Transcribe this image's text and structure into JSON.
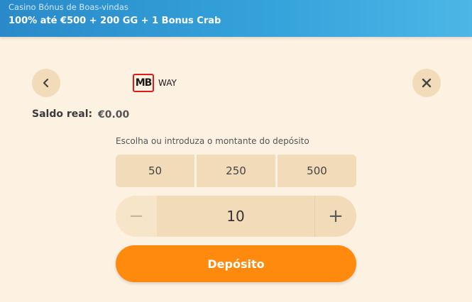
{
  "banner": {
    "subtitle": "Casino Bónus de Boas-vindas",
    "title": "100% até €500 + 200 GG + 1 Bonus Crab"
  },
  "header": {
    "logo_mb": "MB",
    "logo_way": "WAY",
    "back_icon": "chevron-left-icon",
    "close_icon": "close-icon"
  },
  "balance": {
    "label": "Saldo real:",
    "value": "€0.00"
  },
  "deposit": {
    "hint": "Escolha ou introduza o montante do depósito",
    "presets": [
      "50",
      "250",
      "500"
    ],
    "amount": "10",
    "minus": "−",
    "plus": "+",
    "submit_label": "Depósito"
  },
  "colors": {
    "background": "#fdf1e2",
    "accent": "#ff8a0d",
    "chip": "#f2dbb8",
    "banner": "#35a4dc",
    "logo_red": "#e0191a"
  }
}
